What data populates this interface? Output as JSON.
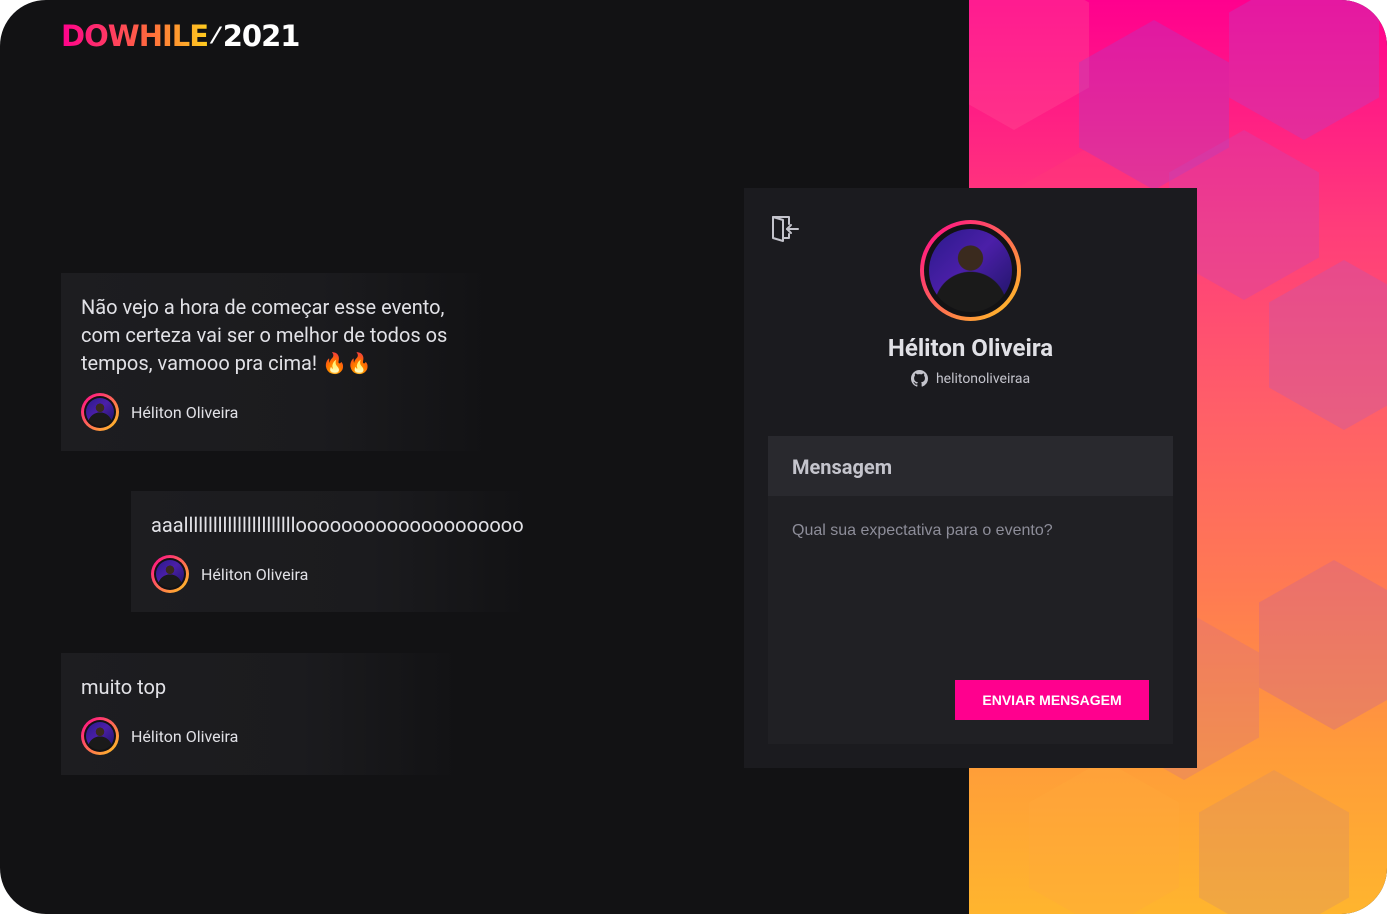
{
  "logo": {
    "brand": "DOWHILE",
    "year": "2021"
  },
  "messages": [
    {
      "text": "Não vejo a hora de começar esse evento, com certeza vai ser o melhor de todos os tempos, vamooo pra cima! 🔥🔥",
      "author": "Héliton Oliveira"
    },
    {
      "text": "aaallllllllllllllllllllllloooooooooooooooooooo",
      "author": "Héliton Oliveira"
    },
    {
      "text": "muito top",
      "author": "Héliton Oliveira"
    }
  ],
  "profile": {
    "name": "Héliton Oliveira",
    "github_login": "helitonoliveiraa"
  },
  "form": {
    "header": "Mensagem",
    "placeholder": "Qual sua expectativa para o evento?",
    "submit_label": "Enviar mensagem"
  },
  "colors": {
    "accent": "#ff008e",
    "background": "#121214",
    "panel": "#1b1b1f",
    "gradient_start": "#ff008e",
    "gradient_end": "#ffcd1e"
  },
  "icons": {
    "signout": "sign-out-door-icon",
    "github": "github-icon"
  }
}
